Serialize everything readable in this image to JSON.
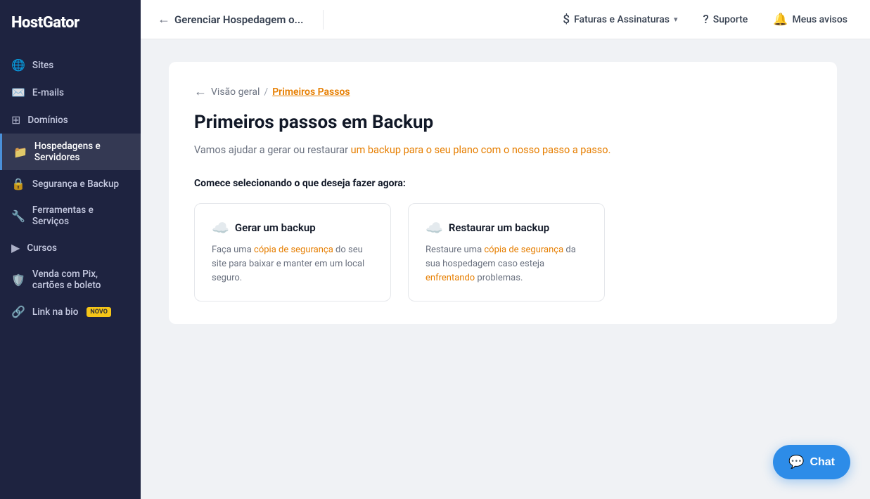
{
  "sidebar": {
    "logo": "HostGator",
    "items": [
      {
        "id": "sites",
        "label": "Sites",
        "icon": "🌐"
      },
      {
        "id": "emails",
        "label": "E-mails",
        "icon": "✉️"
      },
      {
        "id": "dominios",
        "label": "Domínios",
        "icon": "🔲"
      },
      {
        "id": "hospedagens",
        "label": "Hospedagens e Servidores",
        "icon": "📁",
        "active": true
      },
      {
        "id": "seguranca",
        "label": "Segurança e Backup",
        "icon": "🔒"
      },
      {
        "id": "ferramentas",
        "label": "Ferramentas e Serviços",
        "icon": "🔧"
      },
      {
        "id": "cursos",
        "label": "Cursos",
        "icon": "▶️"
      },
      {
        "id": "venda",
        "label": "Venda com Pix, cartões e boleto",
        "icon": "🛡️"
      },
      {
        "id": "link",
        "label": "Link na bio",
        "icon": "🔗",
        "badge": "NOVO"
      }
    ]
  },
  "topnav": {
    "back_label": "Gerenciar Hospedagem o...",
    "faturas_label": "Faturas e Assinaturas",
    "suporte_label": "Suporte",
    "avisos_label": "Meus avisos"
  },
  "breadcrumb": {
    "back_arrow": "←",
    "link_label": "Visão geral",
    "separator": "/",
    "current_label": "Primeiros Passos"
  },
  "page": {
    "title": "Primeiros passos em Backup",
    "description_parts": [
      {
        "text": "Vamos ajudar a gerar ou restaurar "
      },
      {
        "text": "um backup para o seu plano com o nosso passo a passo.",
        "highlight": true
      }
    ],
    "description_full": "Vamos ajudar a gerar ou restaurar um backup para o seu plano com o nosso passo a passo.",
    "section_label": "Comece selecionando o que deseja fazer agora:"
  },
  "options": [
    {
      "id": "gerar",
      "emoji": "☁️",
      "title": "Gerar um backup",
      "description_full": "Faça uma cópia de segurança do seu site para baixar e manter em um local seguro.",
      "desc_parts": [
        {
          "text": "Faça uma "
        },
        {
          "text": "cópia de segurança",
          "highlight": true
        },
        {
          "text": " do seu site para baixar e manter em um local seguro."
        }
      ]
    },
    {
      "id": "restaurar",
      "emoji": "☁️",
      "title": "Restaurar um backup",
      "description_full": "Restaure uma cópia de segurança da sua hospedagem caso esteja enfrentando problemas.",
      "desc_parts": [
        {
          "text": "Restaure uma "
        },
        {
          "text": "cópia de segurança",
          "highlight": true
        },
        {
          "text": " da sua hospedagem caso esteja "
        },
        {
          "text": "enfrentando",
          "highlight": true
        },
        {
          "text": " problemas."
        }
      ]
    }
  ],
  "chat": {
    "label": "Chat",
    "icon": "💬"
  }
}
